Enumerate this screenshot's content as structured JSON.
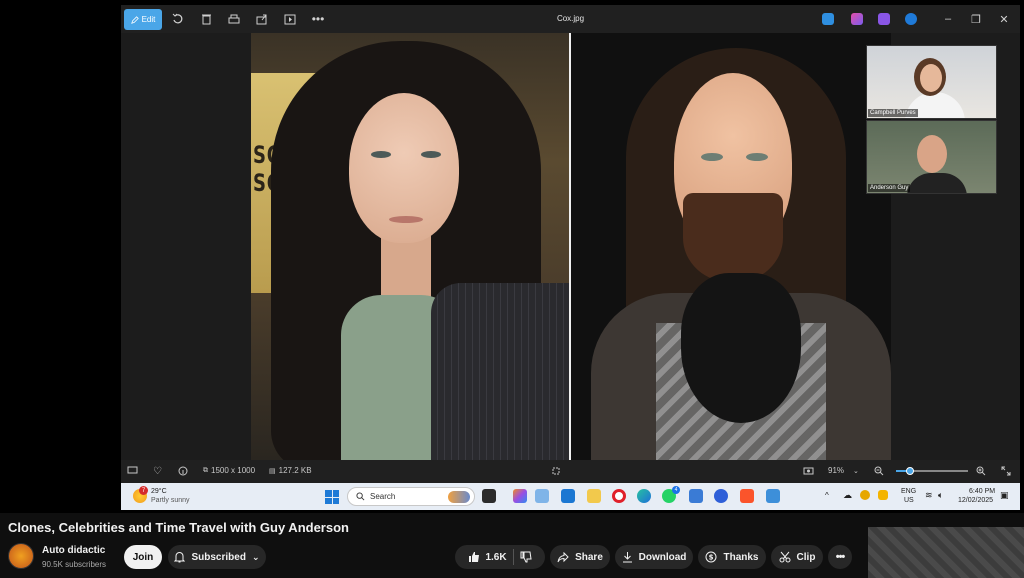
{
  "viewer": {
    "edit_label": "Edit",
    "filename": "Cox.jpg",
    "dimensions": "1500 x 1000",
    "file_size": "127.2 KB",
    "zoom": "91%",
    "zoom_level_fraction": 0.19
  },
  "photo_left": {
    "sign_text": "SOPHIE A\nSCA"
  },
  "participants": [
    {
      "name": "Campbell Purves"
    },
    {
      "name": "Anderson Guy"
    }
  ],
  "taskbar": {
    "weather_temp": "29°C",
    "weather_desc": "Partly sunny",
    "weather_badge": "7",
    "search_placeholder": "Search",
    "lang_line1": "ENG",
    "lang_line2": "US",
    "time": "6:40 PM",
    "date": "12/02/2025",
    "whatsapp_badge": "4"
  },
  "video": {
    "title": "Clones, Celebrities and Time Travel with Guy Anderson",
    "channel": "Auto didactic",
    "subscribers": "90.5K subscribers",
    "join_label": "Join",
    "subscribed_label": "Subscribed",
    "likes": "1.6K",
    "share_label": "Share",
    "download_label": "Download",
    "thanks_label": "Thanks",
    "clip_label": "Clip"
  },
  "colors": {
    "accent": "#4aa6e8",
    "page_bg": "#0f0f0f",
    "pill_bg": "#272727"
  }
}
